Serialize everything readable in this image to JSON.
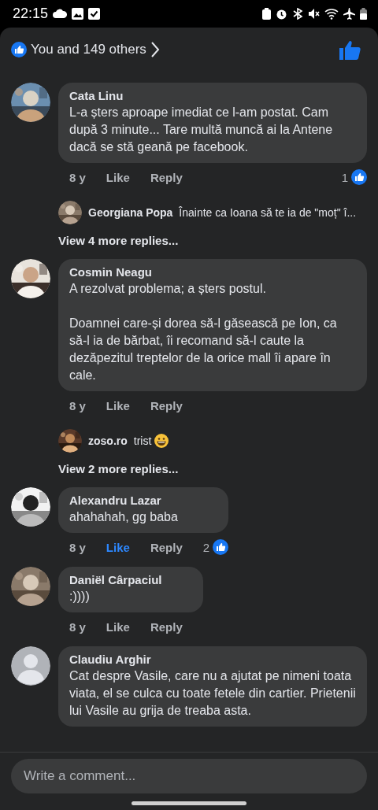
{
  "status_bar": {
    "time": "22:15"
  },
  "header": {
    "reactions": "You and 149 others",
    "liked": true
  },
  "comments": [
    {
      "name": "Cata Linu",
      "avatar": {
        "kind": "picture"
      },
      "paragraphs": [
        "L-a șters aproape imediat ce l-am postat. Cam după 3 minute... Tare multă muncă ai la Antene dacă se stă geană pe facebook."
      ],
      "time": "8 y",
      "like": "Like",
      "reply": "Reply",
      "liked": false,
      "like_count": "1",
      "reply_preview": {
        "name": "Georgiana Popa",
        "text": "Înainte ca Ioana să te ia de \"moț\" î...",
        "emoji": false
      },
      "more_replies": "View 4 more replies..."
    },
    {
      "name": "Cosmin Neagu",
      "avatar": {
        "kind": "picture"
      },
      "paragraphs": [
        "A rezolvat problema; a șters postul.",
        "Doamnei care-și dorea să-l găsească pe Ion, ca să-l ia de bărbat, îi recomand să-l caute la dezăpezitul treptelor de la orice mall îi apare în cale."
      ],
      "time": "8 y",
      "like": "Like",
      "reply": "Reply",
      "liked": false,
      "reply_preview": {
        "name": "zoso.ro",
        "text": "trist",
        "emoji": true
      },
      "more_replies": "View 2 more replies..."
    },
    {
      "name": "Alexandru Lazar",
      "avatar": {
        "kind": "picture"
      },
      "paragraphs": [
        "ahahahah, gg baba"
      ],
      "time": "8 y",
      "like": "Like",
      "reply": "Reply",
      "liked": true,
      "like_count": "2"
    },
    {
      "name": "Daniël Cârpaciul",
      "avatar": {
        "kind": "picture"
      },
      "paragraphs": [
        ":))))"
      ],
      "time": "8 y",
      "like": "Like",
      "reply": "Reply",
      "liked": false
    },
    {
      "name": "Claudiu Arghir",
      "avatar": {
        "kind": "silhouette"
      },
      "paragraphs": [
        "Cat despre Vasile, care nu a ajutat pe nimeni toata viata, el se culca cu toate fetele din cartier. Prietenii lui Vasile au grija de treaba asta."
      ]
    }
  ],
  "composer": {
    "placeholder": "Write a comment..."
  }
}
